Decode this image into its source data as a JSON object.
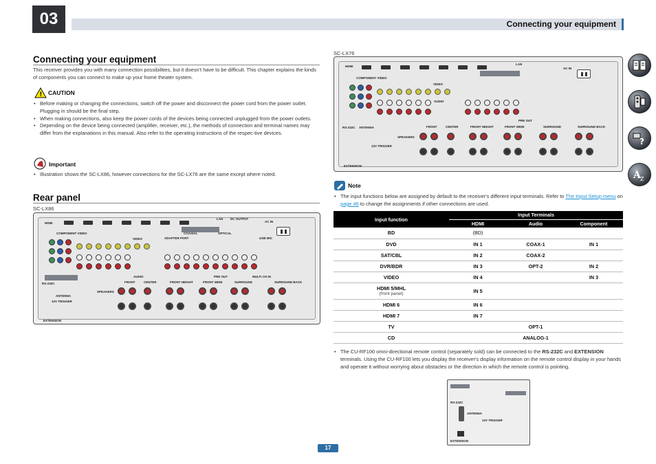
{
  "chapter": "03",
  "header_title": "Connecting your equipment",
  "section1": {
    "title": "Connecting your equipment",
    "intro": "This receiver provides you with many connection possibilities, but it doesn't have to be difficult. This chapter explains the kinds of components you can connect to make up your home theater system.",
    "caution_label": "CAUTION",
    "caution_items": [
      "Before making or changing the connections, switch off the power and disconnect the power cord from the power outlet. Plugging in should be the final step.",
      "When making connections, also keep the power cords of the devices being connected unplugged from the power outlets.",
      "Depending on the device being connected (amplifier, receiver, etc.), the methods of connection and terminal names may differ from the explanations in this manual. Also refer to the operating instructions of the respec-tive devices."
    ],
    "important_label": "Important",
    "important_items": [
      "Illustration shows the SC-LX86, however connections for the SC-LX76 are the same except where noted."
    ]
  },
  "section2": {
    "title": "Rear panel",
    "caption_lx86": "SC-LX86",
    "caption_lx76": "SC-LX76"
  },
  "panel_labels": {
    "hdmi": "HDMI",
    "component_video": "COMPONENT VIDEO",
    "video": "VIDEO",
    "audio": "AUDIO",
    "coaxial": "COAXIAL",
    "optical": "OPTICAL",
    "lan": "LAN",
    "ac_in": "AC IN",
    "antenna": "ANTENNA",
    "rs232c": "RS-232C",
    "trigger": "12V TRIGGER",
    "extension": "EXTENSION",
    "speakers": "SPEAKERS",
    "front": "FRONT",
    "center": "CENTER",
    "front_height": "FRONT HEIGHT",
    "front_wide": "FRONT WIDE",
    "surround": "SURROUND",
    "surround_back": "SURROUND BACK",
    "pre_out": "PRE OUT",
    "multi_ch_in": "MULTI CH IN",
    "bd_in": "BD IN",
    "usb_mic": "USB MIC",
    "dc_output": "DC OUTPUT",
    "adapter_port": "ADAPTER PORT",
    "signal_gnd": "SIGNAL GND",
    "am_loop": "AM LOOP",
    "fm_unbal": "FM UNBAL 75 Ω",
    "out": "OUT",
    "zone2_out": "ZONE 2 OUT",
    "zone3_out": "ZONE 3 OUT",
    "in1": "IN 1",
    "in2": "IN 2",
    "in3": "IN 3",
    "assignable": "ASSIGNABLE"
  },
  "note": {
    "label": "Note",
    "text_before_link": "The input functions below are assigned by default to the receiver's different input terminals. Refer to ",
    "link1": "The Input Setup menu",
    "text_mid": " on ",
    "link2": "page 46",
    "text_after": " to change the assignments if other connections are used."
  },
  "table": {
    "col_input_function": "Input function",
    "col_input_terminals": "Input Terminals",
    "col_hdmi": "HDMI",
    "col_audio": "Audio",
    "col_component": "Component",
    "rows": [
      {
        "fn": "BD",
        "sub": "",
        "hdmi": "(BD)",
        "audio": "",
        "component": ""
      },
      {
        "fn": "DVD",
        "sub": "",
        "hdmi": "IN 1",
        "audio": "COAX-1",
        "component": "IN 1"
      },
      {
        "fn": "SAT/CBL",
        "sub": "",
        "hdmi": "IN 2",
        "audio": "COAX-2",
        "component": ""
      },
      {
        "fn": "DVR/BDR",
        "sub": "",
        "hdmi": "IN 3",
        "audio": "OPT-2",
        "component": "IN 2"
      },
      {
        "fn": "VIDEO",
        "sub": "",
        "hdmi": "IN 4",
        "audio": "",
        "component": "IN 3"
      },
      {
        "fn": "HDMI 5/MHL",
        "sub": "(front panel)",
        "hdmi": "IN 5",
        "audio": "",
        "component": ""
      },
      {
        "fn": "HDMI 6",
        "sub": "",
        "hdmi": "IN 6",
        "audio": "",
        "component": ""
      },
      {
        "fn": "HDMI 7",
        "sub": "",
        "hdmi": "IN 7",
        "audio": "",
        "component": ""
      },
      {
        "fn": "TV",
        "sub": "",
        "hdmi": "",
        "audio": "OPT-1",
        "component": ""
      },
      {
        "fn": "CD",
        "sub": "",
        "hdmi": "",
        "audio": "ANALOG-1",
        "component": ""
      }
    ]
  },
  "bottom_note": {
    "text1": "The CU-RF100 omni-directional remote control (separately sold) can be connected to the ",
    "bold1": "RS-232C",
    "text2": " and ",
    "bold2": "EXTENSION",
    "text3": " terminals. Using the CU-RF100 lets you display the receiver's display information on the remote control display in your hands and operate it without worrying about obstacles or the direction in which the remote control is pointing."
  },
  "page_number": "17",
  "colors": {
    "accent": "#2d6ea3",
    "header_bg": "#d9dde6",
    "chapter_tab": "#2f3137",
    "link": "#1a8fd6",
    "jack_red": "#b8292e",
    "jack_green": "#3d8f5a",
    "jack_blue": "#2d5ca8",
    "jack_yellow": "#c9c43a"
  },
  "side_icons": [
    "manual-book-icon",
    "remote-control-icon",
    "help-question-icon",
    "index-a-icon"
  ]
}
